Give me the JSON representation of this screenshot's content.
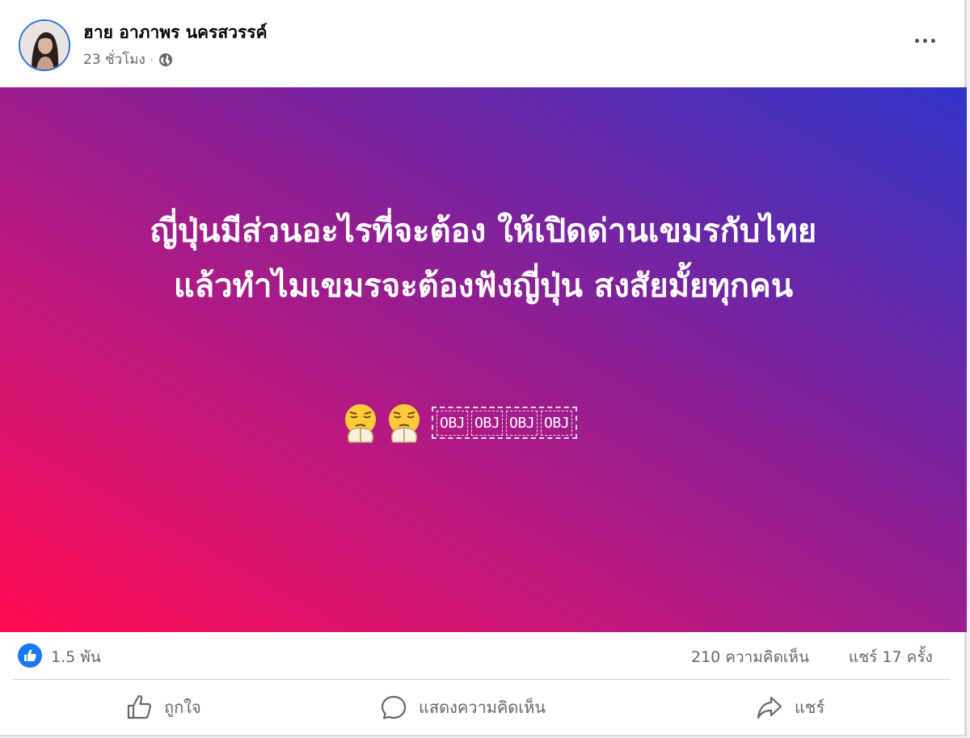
{
  "post": {
    "author": "ฮาย อาภาพร นครสวรรค์",
    "time": "23 ชั่วโมง",
    "audience_icon": "globe-icon",
    "text_lines": [
      "ญี่ปุ่นมีส่วนอะไรที่จะต้อง ให้เปิดด่านเขมรกับไทย",
      "แล้วทำไมเขมรจะต้องฟังญี่ปุ่น สงสัยมั้ยทุกคน"
    ],
    "emoji_name": "persevering-face-pray-emoji",
    "placeholders": [
      "OBJ",
      "OBJ",
      "OBJ",
      "OBJ"
    ],
    "gradient_colors": [
      "#ff0a50",
      "#8a1f95",
      "#3134c8"
    ]
  },
  "stats": {
    "likes": "1.5 พัน",
    "comments": "210 ความคิดเห็น",
    "shares": "แชร์ 17 ครั้ง"
  },
  "actions": {
    "like_label": "ถูกใจ",
    "comment_label": "แสดงความคิดเห็น",
    "share_label": "แชร์"
  },
  "colors": {
    "like_blue": "#1877f2",
    "muted_text": "#65676b"
  }
}
